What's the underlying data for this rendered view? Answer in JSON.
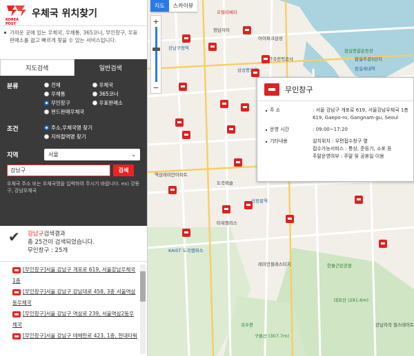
{
  "header": {
    "title": "우체국 위치찾기",
    "logo_text": "KOREA POST"
  },
  "intro": "가까운 곳에 있는 우체국, 우체통, 365코너, 무인창구, 우표판매소를 쉽고 빠르게 찾을 수 있는 서비스입니다.",
  "tabs": [
    {
      "label": "지도검색"
    },
    {
      "label": "일반검색"
    }
  ],
  "filters": {
    "category_label": "분류",
    "category_options": [
      "전체",
      "우체국",
      "우체통",
      "365코너",
      "무인창구",
      "우표판매소",
      "편드판매우체국"
    ],
    "category_selected": "무인창구",
    "condition_label": "조건",
    "condition_options": [
      "주소,우체국명 찾기",
      "지하철역명 찾기"
    ],
    "condition_selected": "주소,우체국명 찾기",
    "region_label": "지역",
    "region_value": "서울",
    "search_value": "강남구",
    "search_button": "검색",
    "help_text": "우체국 주소 또는 우체국명을 입력하여 주시기 바랍니다. ex) 강동구, 강남우체국"
  },
  "result": {
    "keyword": "강남구",
    "suffix": "검색결과",
    "count_text": "총 25건이 검색되었습니다.",
    "detail": "무인창구 : 25개"
  },
  "results_list": [
    {
      "label": "[무인창구]서울 강남구 개포로 619, 서울강남우체국 1층"
    },
    {
      "label": "[무인창구]서울 강남구 강남대로 458, 3층 서울역삼동우체국"
    },
    {
      "label": "[무인창구]서울 강남구 역삼로 239, 서울역삼2동우체국"
    },
    {
      "label": "[무인창구]서울 강남구 테헤란로 423, 1층, 현대타워"
    }
  ],
  "map": {
    "tabs": [
      "지도",
      "스카이뷰"
    ],
    "zoom_in": "+",
    "zoom_out": "−",
    "labels": [
      {
        "text": "호텔리베라"
      },
      {
        "text": "아이파크삼성"
      },
      {
        "text": "청담자이"
      },
      {
        "text": "강남구청역"
      },
      {
        "text": "한국전력공사"
      },
      {
        "text": "삼성중앙역"
      },
      {
        "text": "잠실종합운동장"
      },
      {
        "text": "잠실주공5단지"
      },
      {
        "text": "잠실새내역"
      },
      {
        "text": "역삼래미안아파트"
      },
      {
        "text": "도곡렉슬"
      },
      {
        "text": "선정릉역"
      },
      {
        "text": "타워팰리스"
      },
      {
        "text": "KAIST 도곡캠퍼스"
      },
      {
        "text": "래미안블레스티지"
      },
      {
        "text": "대모산 (291.6m)"
      },
      {
        "text": "구룡산 (307.7m)"
      },
      {
        "text": "한솔근린공원"
      },
      {
        "text": "국수봉"
      },
      {
        "text": "강남자곡 힐스테이트아파트"
      }
    ]
  },
  "popup": {
    "title": "무인창구",
    "address_label": "주 소",
    "address_value": ": 서울 강남구 개포로 619, 서울강남우체국 1층",
    "address_en": "619, Gaepo-ro, Gangnam-gu, Seoul",
    "hours_label": "운영 시간",
    "hours_value": ": 09:00~17:20",
    "etc_label": "기타내용",
    "etc_lines": [
      "설치위치 : 우편접수창구 옆",
      "접수가능서비스 : 통상, 준등기, 소포 등",
      "주말운영여부 : 주말 및 공휴일 이용"
    ]
  },
  "colors": {
    "accent": "#e22222",
    "dark_panel": "#3a3a3a",
    "map_tab_active": "#2a7ae2"
  }
}
